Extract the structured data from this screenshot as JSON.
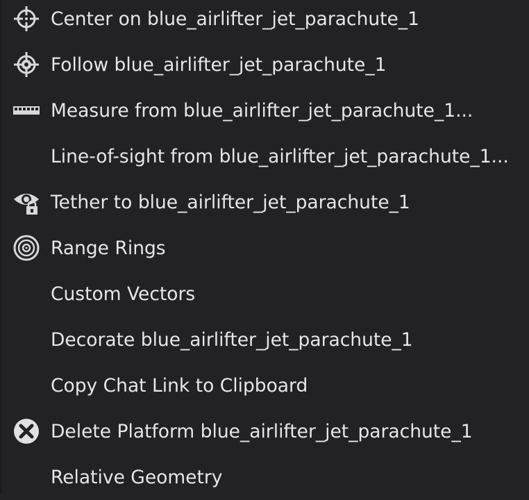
{
  "menu": {
    "items": [
      {
        "label": "Center on blue_airlifter_jet_parachute_1",
        "icon": "crosshair-icon"
      },
      {
        "label": "Follow blue_airlifter_jet_parachute_1",
        "icon": "follow-crosshair-icon"
      },
      {
        "label": "Measure from blue_airlifter_jet_parachute_1...",
        "icon": "ruler-icon"
      },
      {
        "label": "Line-of-sight from blue_airlifter_jet_parachute_1...",
        "icon": ""
      },
      {
        "label": "Tether to blue_airlifter_jet_parachute_1",
        "icon": "tether-eye-lock-icon"
      },
      {
        "label": "Range Rings",
        "icon": "range-rings-icon"
      },
      {
        "label": "Custom Vectors",
        "icon": ""
      },
      {
        "label": "Decorate blue_airlifter_jet_parachute_1",
        "icon": ""
      },
      {
        "label": "Copy Chat Link to Clipboard",
        "icon": ""
      },
      {
        "label": "Delete Platform blue_airlifter_jet_parachute_1",
        "icon": "delete-x-circle-icon"
      },
      {
        "label": "Relative Geometry",
        "icon": ""
      }
    ]
  },
  "colors": {
    "background": "#222224",
    "text": "#e6e6e6",
    "icon": "#d8d8d8"
  }
}
